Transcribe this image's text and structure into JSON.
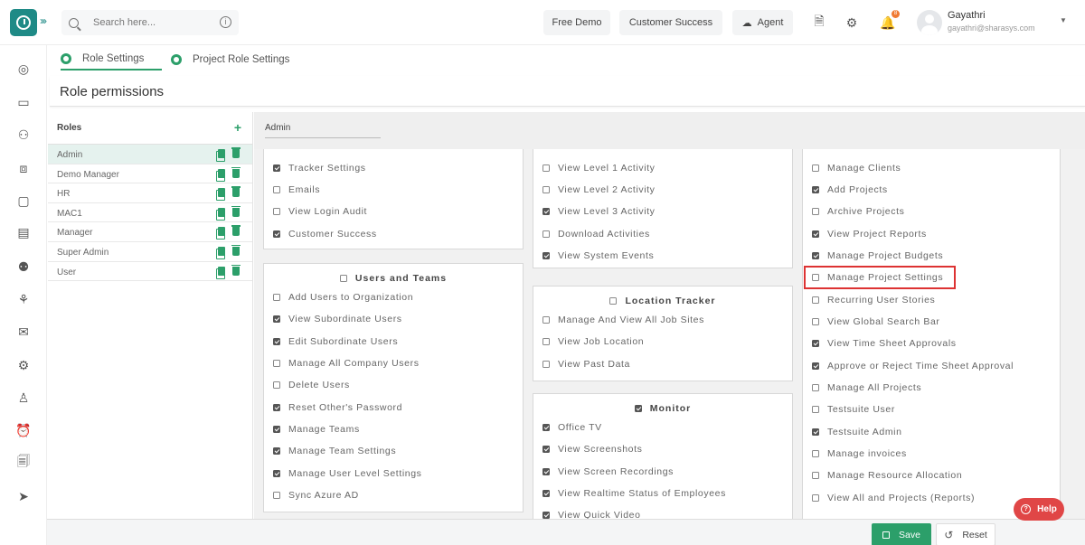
{
  "header": {
    "search_placeholder": "Search here...",
    "free_demo": "Free Demo",
    "customer_success": "Customer Success",
    "agent": "Agent",
    "notification_count": "8",
    "user_name": "Gayathri",
    "user_email": "gayathri@sharasys.com"
  },
  "tabs": [
    {
      "label": "Role Settings"
    },
    {
      "label": "Project Role Settings"
    }
  ],
  "page_title": "Role permissions",
  "roles": {
    "heading": "Roles",
    "add_symbol": "+",
    "items": [
      "Admin",
      "Demo Manager",
      "HR",
      "MAC1",
      "Manager",
      "Super Admin",
      "User"
    ]
  },
  "selected_role": "Admin",
  "col1_top": [
    {
      "label": "Tracker Settings",
      "checked": true
    },
    {
      "label": "Emails",
      "checked": false
    },
    {
      "label": "View Login Audit",
      "checked": false
    },
    {
      "label": "Customer Success",
      "checked": true
    }
  ],
  "users_teams": {
    "title": "Users and Teams",
    "items": [
      {
        "label": "Add Users to Organization",
        "checked": false
      },
      {
        "label": "View Subordinate Users",
        "checked": true
      },
      {
        "label": "Edit Subordinate Users",
        "checked": true
      },
      {
        "label": "Manage All Company Users",
        "checked": false
      },
      {
        "label": "Delete Users",
        "checked": false
      },
      {
        "label": "Reset Other's Password",
        "checked": true
      },
      {
        "label": "Manage Teams",
        "checked": true
      },
      {
        "label": "Manage Team Settings",
        "checked": true
      },
      {
        "label": "Manage User Level Settings",
        "checked": true
      },
      {
        "label": "Sync Azure AD",
        "checked": false
      }
    ]
  },
  "col2_top": [
    {
      "label": "View Level 1 Activity",
      "checked": false
    },
    {
      "label": "View Level 2 Activity",
      "checked": false
    },
    {
      "label": "View Level 3 Activity",
      "checked": true
    },
    {
      "label": "Download Activities",
      "checked": false
    },
    {
      "label": "View System Events",
      "checked": true
    }
  ],
  "location_tracker": {
    "title": "Location Tracker",
    "items": [
      {
        "label": "Manage And View All Job Sites",
        "checked": false
      },
      {
        "label": "View Job Location",
        "checked": false
      },
      {
        "label": "View Past Data",
        "checked": false
      }
    ]
  },
  "monitor": {
    "title": "Monitor",
    "items": [
      {
        "label": "Office TV",
        "checked": true
      },
      {
        "label": "View Screenshots",
        "checked": true
      },
      {
        "label": "View Screen Recordings",
        "checked": true
      },
      {
        "label": "View Realtime Status of Employees",
        "checked": true
      },
      {
        "label": "View Quick Video",
        "checked": true
      }
    ]
  },
  "col3": [
    {
      "label": "Manage Clients",
      "checked": false
    },
    {
      "label": "Add Projects",
      "checked": true
    },
    {
      "label": "Archive Projects",
      "checked": false
    },
    {
      "label": "View Project Reports",
      "checked": true
    },
    {
      "label": "Manage Project Budgets",
      "checked": true
    },
    {
      "label": "Manage Project Settings",
      "checked": false
    },
    {
      "label": "Recurring User Stories",
      "checked": false
    },
    {
      "label": "View Global Search Bar",
      "checked": false
    },
    {
      "label": "View Time Sheet Approvals",
      "checked": true
    },
    {
      "label": "Approve or Reject Time Sheet Approval",
      "checked": true
    },
    {
      "label": "Manage All Projects",
      "checked": false
    },
    {
      "label": "Testsuite User",
      "checked": false
    },
    {
      "label": "Testsuite Admin",
      "checked": true
    },
    {
      "label": "Manage invoices",
      "checked": false
    },
    {
      "label": "Manage Resource Allocation",
      "checked": false
    },
    {
      "label": "View All and Projects (Reports)",
      "checked": false
    }
  ],
  "footer": {
    "save": "Save",
    "reset": "Reset"
  },
  "help": "Help",
  "colors": {
    "accent": "#2c9f6a",
    "brand": "#1f8a86",
    "highlight": "#dd3333",
    "help": "#e04646"
  }
}
